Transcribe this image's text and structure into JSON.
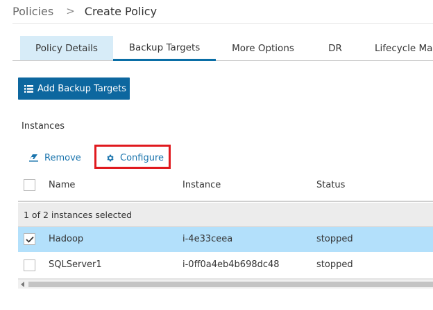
{
  "breadcrumb": {
    "root": "Policies",
    "separator": ">",
    "current": "Create Policy"
  },
  "tabs": [
    {
      "label": "Policy Details",
      "state": "done"
    },
    {
      "label": "Backup Targets",
      "state": "active"
    },
    {
      "label": "More Options",
      "state": "default"
    },
    {
      "label": "DR",
      "state": "default"
    },
    {
      "label": "Lifecycle Mar",
      "state": "default"
    }
  ],
  "add_button": {
    "label": "Add Backup Targets",
    "icon": "list-icon"
  },
  "section_title": "Instances",
  "actions": {
    "remove": {
      "label": "Remove",
      "icon": "eraser-icon"
    },
    "configure": {
      "label": "Configure",
      "icon": "gear-icon",
      "highlighted": true
    }
  },
  "table": {
    "columns": {
      "name": "Name",
      "instance": "Instance",
      "status": "Status"
    },
    "selection_info": "1 of 2 instances selected",
    "rows": [
      {
        "name": "Hadoop",
        "instance": "i-4e33ceea",
        "status": "stopped",
        "checked": true
      },
      {
        "name": "SQLServer1",
        "instance": "i-0ff0a4eb4b698dc48",
        "status": "stopped",
        "checked": false
      }
    ]
  },
  "colors": {
    "accent": "#0d679f",
    "link": "#1a74ad",
    "selected_row": "#b3e0fb",
    "done_tab": "#d7ecf8",
    "highlight": "#e0191e"
  }
}
